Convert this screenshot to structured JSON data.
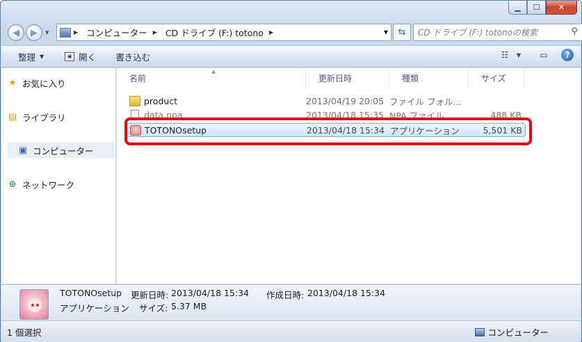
{
  "window": {
    "minimize": "▁",
    "maximize": "☐",
    "close": "✕"
  },
  "address": {
    "crumbs": [
      "コンピューター",
      "CD ドライブ (F:) totono"
    ],
    "search_placeholder": "CD ドライブ (F:) totonoの検索"
  },
  "toolbar": {
    "organize": "整理",
    "open": "開く",
    "burn": "書き込む"
  },
  "nav": {
    "favorites": "お気に入り",
    "libraries": "ライブラリ",
    "computer": "コンピューター",
    "network": "ネットワーク"
  },
  "columns": {
    "name": "名前",
    "date": "更新日時",
    "type": "種類",
    "size": "サイズ"
  },
  "files": [
    {
      "name": "product",
      "date": "2013/04/19 20:05",
      "type": "ファイル フォル...",
      "size": ""
    },
    {
      "name": "data.npa",
      "date": "2013/04/18 15:35",
      "type": "NPA ファイル",
      "size": "488 KB"
    },
    {
      "name": "TOTONOsetup",
      "date": "2013/04/18 15:34",
      "type": "アプリケーション",
      "size": "5,501 KB"
    }
  ],
  "details": {
    "name": "TOTONOsetup",
    "modified_label": "更新日時:",
    "modified": "2013/04/18 15:34",
    "created_label": "作成日時:",
    "created": "2013/04/18 15:34",
    "type": "アプリケーション",
    "size_label": "サイズ:",
    "size": "5.37 MB"
  },
  "status": {
    "selection": "1 個選択",
    "location": "コンピューター"
  },
  "colors": {
    "highlight": "#e8000f",
    "accent": "#1e395b"
  }
}
